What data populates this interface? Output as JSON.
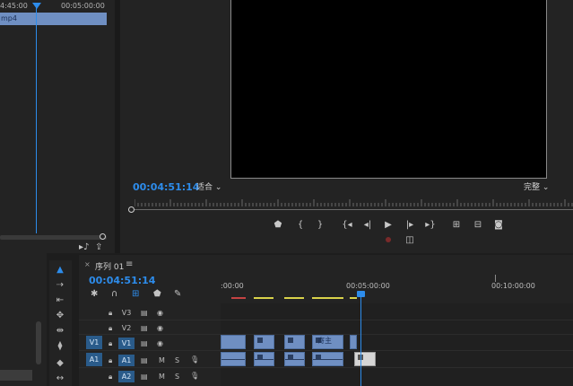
{
  "source_monitor": {
    "ruler_left": "4:45:00",
    "ruler_right": "00:05:00:00",
    "clip_name": "mp4"
  },
  "program_monitor": {
    "timecode": "00:04:51:14",
    "fit_value": "适合",
    "quality_value": "完整"
  },
  "controls": [
    "marker-icon",
    "mark-in-icon",
    "mark-out-icon",
    "go-to-in-icon",
    "step-back-icon",
    "play-icon",
    "step-forward-icon",
    "go-to-out-icon",
    "lift-icon",
    "extract-icon",
    "export-frame-icon"
  ],
  "timeline": {
    "sequence_name": "序列 01",
    "menu_glyph": "≡",
    "timecode": "00:04:51:14",
    "ruler_labels": [
      ":00:00",
      "00:05:00:00",
      "00:10:00:00"
    ],
    "tracks": [
      {
        "name": "V3",
        "source": ""
      },
      {
        "name": "V2",
        "source": ""
      },
      {
        "name": "V1",
        "source": "V1"
      },
      {
        "name": "A1",
        "source": "A1"
      },
      {
        "name": "A2",
        "source": ""
      }
    ],
    "clip_label": "寄主",
    "toggle_m": "M",
    "toggle_s": "S"
  },
  "accent_color": "#2d8ceb",
  "clip_color": "#6f8fc2"
}
